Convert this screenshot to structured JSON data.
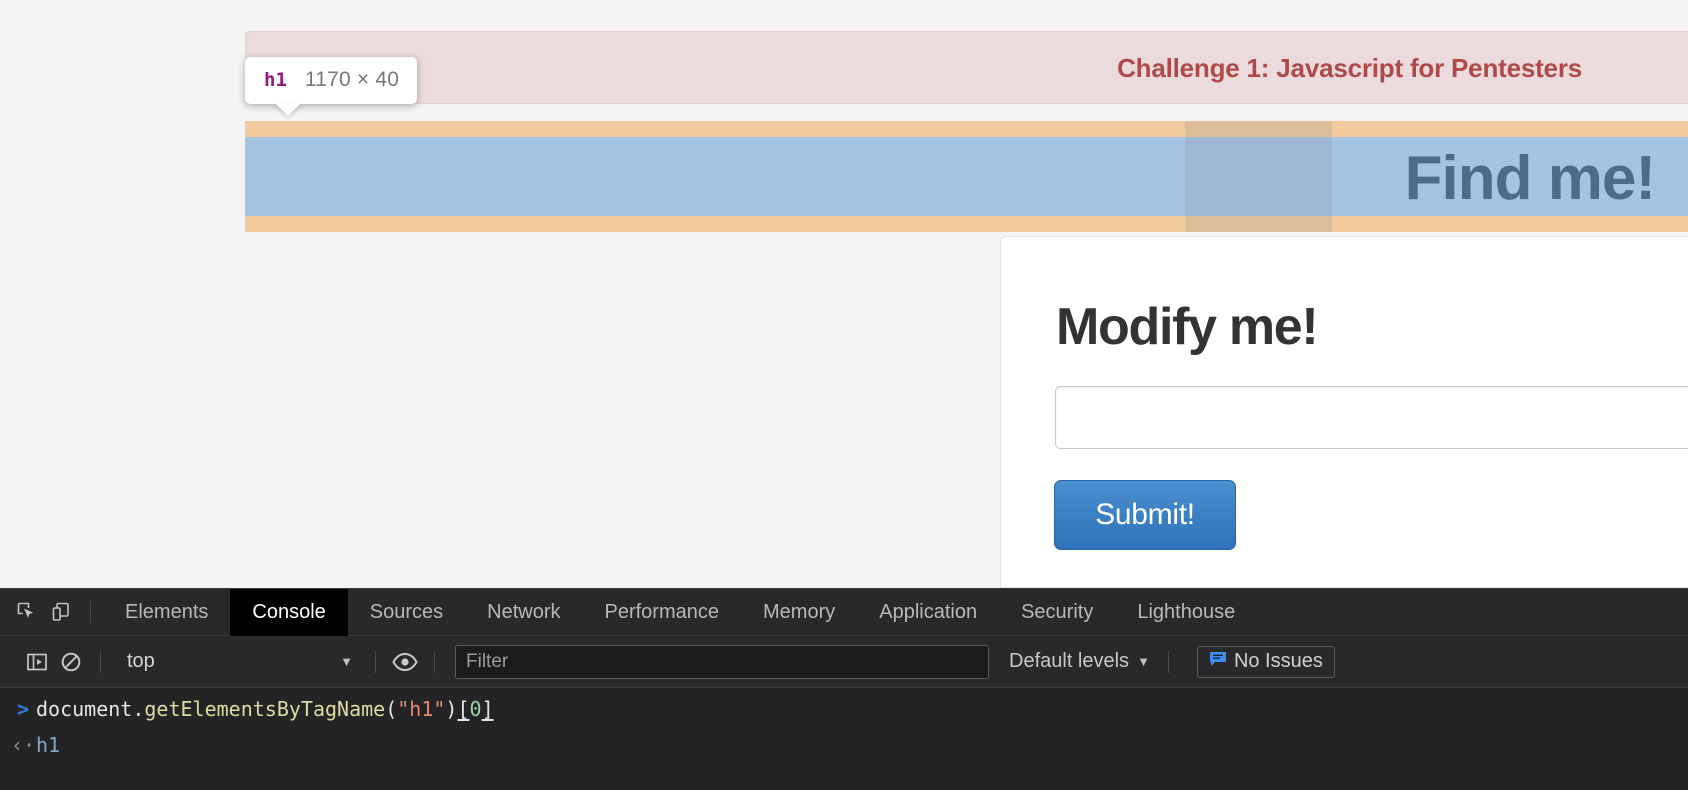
{
  "page": {
    "banner": {
      "text": "Challenge 1: Javascript for Pentesters"
    },
    "heading": {
      "text": "Find me!"
    },
    "element_badge": {
      "tag": "h1",
      "dimensions": "1170 × 40"
    },
    "card": {
      "title": "Modify me!",
      "input_value": "",
      "input_placeholder": "",
      "submit_label": "Submit!"
    },
    "colors": {
      "banner_bg": "#ecdbdc",
      "banner_text": "#b04a4a",
      "highlight_content": "#a6c3e1",
      "highlight_padding": "#f1cb9d",
      "heading_text": "#4d6c8c",
      "submit_bg": "#2f72b8"
    }
  },
  "devtools": {
    "left_icons": [
      {
        "name": "inspect-element-icon",
        "label": "Inspect element"
      },
      {
        "name": "device-toolbar-icon",
        "label": "Toggle device toolbar"
      }
    ],
    "tabs": [
      {
        "label": "Elements",
        "active": false
      },
      {
        "label": "Console",
        "active": true
      },
      {
        "label": "Sources",
        "active": false
      },
      {
        "label": "Network",
        "active": false
      },
      {
        "label": "Performance",
        "active": false
      },
      {
        "label": "Memory",
        "active": false
      },
      {
        "label": "Application",
        "active": false
      },
      {
        "label": "Security",
        "active": false
      },
      {
        "label": "Lighthouse",
        "active": false
      }
    ],
    "console_toolbar": {
      "sidebar_icon": "console-sidebar-icon",
      "clear_icon": "clear-console-icon",
      "context": "top",
      "context_caret": "▼",
      "eye_icon": "live-expression-icon",
      "filter_value": "",
      "filter_placeholder": "Filter",
      "levels_label": "Default levels",
      "levels_caret": "▼",
      "issues_label": "No Issues",
      "issues_icon": "issues-message-icon"
    },
    "console_entries": [
      {
        "type": "input",
        "gutter": ">",
        "tokens": [
          {
            "text": "document",
            "kind": "plain"
          },
          {
            "text": ".",
            "kind": "punc"
          },
          {
            "text": "getElementsByTagName",
            "kind": "method"
          },
          {
            "text": "(",
            "kind": "punc"
          },
          {
            "text": "\"h1\"",
            "kind": "string"
          },
          {
            "text": ")",
            "kind": "punc"
          },
          {
            "text": "[",
            "kind": "bracket"
          },
          {
            "text": "0",
            "kind": "num"
          },
          {
            "text": "]",
            "kind": "bracket"
          }
        ]
      },
      {
        "type": "output",
        "gutter": "‹·",
        "value": "h1"
      }
    ]
  }
}
